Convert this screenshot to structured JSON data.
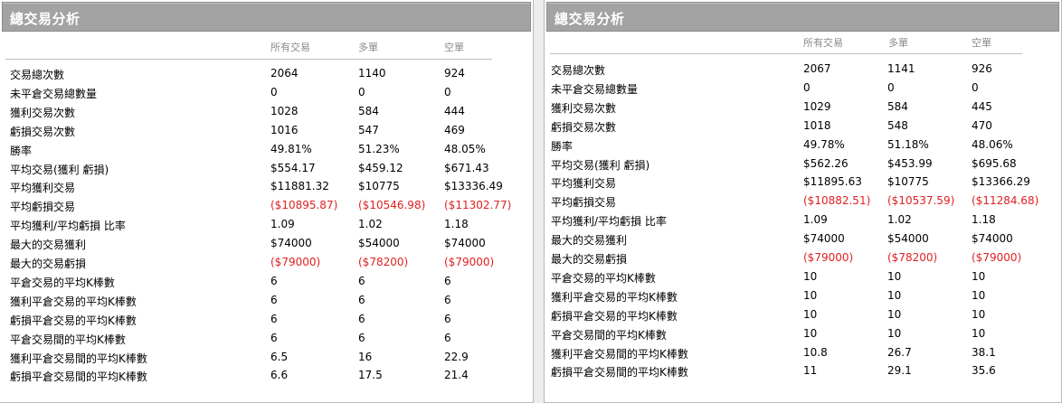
{
  "left": {
    "title": "總交易分析",
    "columns": [
      "所有交易",
      "多單",
      "空單"
    ],
    "rows": [
      {
        "label": "交易總次數",
        "all": "2064",
        "long": "1140",
        "short": "924"
      },
      {
        "label": "未平倉交易總數量",
        "all": "0",
        "long": "0",
        "short": "0"
      },
      {
        "label": "獲利交易次數",
        "all": "1028",
        "long": "584",
        "short": "444"
      },
      {
        "label": "虧損交易次數",
        "all": "1016",
        "long": "547",
        "short": "469"
      },
      {
        "label": "勝率",
        "all": "49.81%",
        "long": "51.23%",
        "short": "48.05%"
      },
      {
        "label": "平均交易(獲利 虧損)",
        "all": "$554.17",
        "long": "$459.12",
        "short": "$671.43"
      },
      {
        "label": "平均獲利交易",
        "all": "$11881.32",
        "long": "$10775",
        "short": "$13336.49"
      },
      {
        "label": "平均虧損交易",
        "all": "($10895.87)",
        "long": "($10546.98)",
        "short": "($11302.77)",
        "negative": true
      },
      {
        "label": "平均獲利/平均虧損 比率",
        "all": "1.09",
        "long": "1.02",
        "short": "1.18"
      },
      {
        "label": "最大的交易獲利",
        "all": "$74000",
        "long": "$54000",
        "short": "$74000"
      },
      {
        "label": "最大的交易虧損",
        "all": "($79000)",
        "long": "($78200)",
        "short": "($79000)",
        "negative": true
      },
      {
        "label": "平倉交易的平均K棒數",
        "all": "6",
        "long": "6",
        "short": "6"
      },
      {
        "label": "獲利平倉交易的平均K棒數",
        "all": "6",
        "long": "6",
        "short": "6"
      },
      {
        "label": "虧損平倉交易的平均K棒數",
        "all": "6",
        "long": "6",
        "short": "6"
      },
      {
        "label": "平倉交易間的平均K棒數",
        "all": "6",
        "long": "6",
        "short": "6"
      },
      {
        "label": "獲利平倉交易間的平均K棒數",
        "all": "6.5",
        "long": "16",
        "short": "22.9"
      },
      {
        "label": "虧損平倉交易間的平均K棒數",
        "all": "6.6",
        "long": "17.5",
        "short": "21.4"
      }
    ]
  },
  "right": {
    "title": "總交易分析",
    "columns": [
      "所有交易",
      "多單",
      "空單"
    ],
    "rows": [
      {
        "label": "交易總次數",
        "all": "2067",
        "long": "1141",
        "short": "926"
      },
      {
        "label": "未平倉交易總數量",
        "all": "0",
        "long": "0",
        "short": "0"
      },
      {
        "label": "獲利交易次數",
        "all": "1029",
        "long": "584",
        "short": "445"
      },
      {
        "label": "虧損交易次數",
        "all": "1018",
        "long": "548",
        "short": "470"
      },
      {
        "label": "勝率",
        "all": "49.78%",
        "long": "51.18%",
        "short": "48.06%"
      },
      {
        "label": "平均交易(獲利 虧損)",
        "all": "$562.26",
        "long": "$453.99",
        "short": "$695.68"
      },
      {
        "label": "平均獲利交易",
        "all": "$11895.63",
        "long": "$10775",
        "short": "$13366.29"
      },
      {
        "label": "平均虧損交易",
        "all": "($10882.51)",
        "long": "($10537.59)",
        "short": "($11284.68)",
        "negative": true
      },
      {
        "label": "平均獲利/平均虧損 比率",
        "all": "1.09",
        "long": "1.02",
        "short": "1.18"
      },
      {
        "label": "最大的交易獲利",
        "all": "$74000",
        "long": "$54000",
        "short": "$74000"
      },
      {
        "label": "最大的交易虧損",
        "all": "($79000)",
        "long": "($78200)",
        "short": "($79000)",
        "negative": true
      },
      {
        "label": "平倉交易的平均K棒數",
        "all": "10",
        "long": "10",
        "short": "10"
      },
      {
        "label": "獲利平倉交易的平均K棒數",
        "all": "10",
        "long": "10",
        "short": "10"
      },
      {
        "label": "虧損平倉交易的平均K棒數",
        "all": "10",
        "long": "10",
        "short": "10"
      },
      {
        "label": "平倉交易間的平均K棒數",
        "all": "10",
        "long": "10",
        "short": "10"
      },
      {
        "label": "獲利平倉交易間的平均K棒數",
        "all": "10.8",
        "long": "26.7",
        "short": "38.1"
      },
      {
        "label": "虧損平倉交易間的平均K棒數",
        "all": "11",
        "long": "29.1",
        "short": "35.6"
      }
    ]
  },
  "colors": {
    "header_bg": "#a3a3a3",
    "negative": "#e02020",
    "column_header": "#8a8a8a"
  }
}
